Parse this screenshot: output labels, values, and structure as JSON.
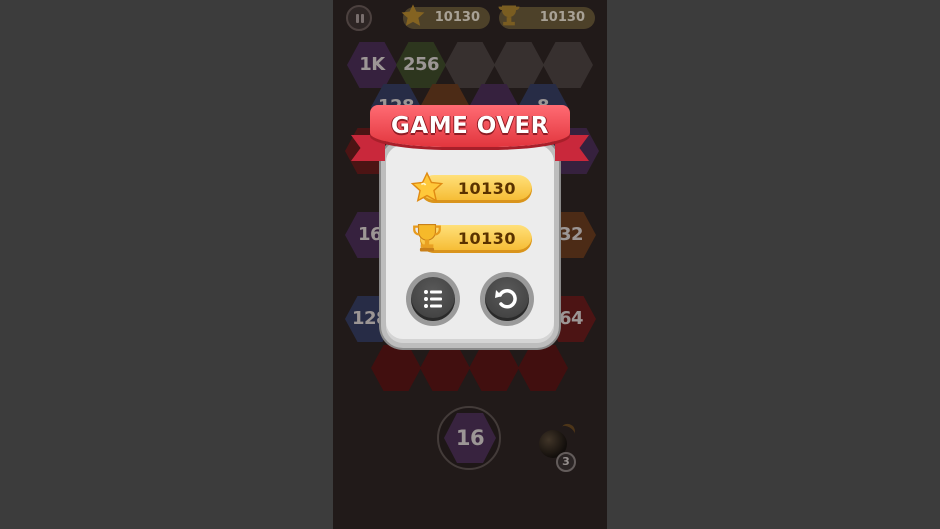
{
  "hud": {
    "score": "10130",
    "best": "10130"
  },
  "board": {
    "tiles": [
      {
        "label": "1K",
        "color": "purple"
      },
      {
        "label": "256",
        "color": "green"
      },
      {
        "label": "",
        "color": "empty"
      },
      {
        "label": "",
        "color": "empty"
      },
      {
        "label": "",
        "color": "empty"
      },
      {
        "label": "128",
        "color": "blue"
      },
      {
        "label": "8",
        "color": "blue"
      },
      {
        "label": "16",
        "color": "purple"
      },
      {
        "label": "32",
        "color": "orange"
      },
      {
        "label": "128",
        "color": "blue"
      },
      {
        "label": "64",
        "color": "red"
      }
    ]
  },
  "next_tile": {
    "label": "16",
    "color": "#4e3158"
  },
  "bomb": {
    "count": "3"
  },
  "dialog": {
    "title": "GAME OVER",
    "score": "10130",
    "best": "10130",
    "buttons": [
      "leaderboard-list",
      "restart"
    ]
  },
  "colors": {
    "ribbon": "#e2363e",
    "bar": "#f5b92e",
    "panel": "#ececec",
    "background": "#3c3c3c"
  }
}
